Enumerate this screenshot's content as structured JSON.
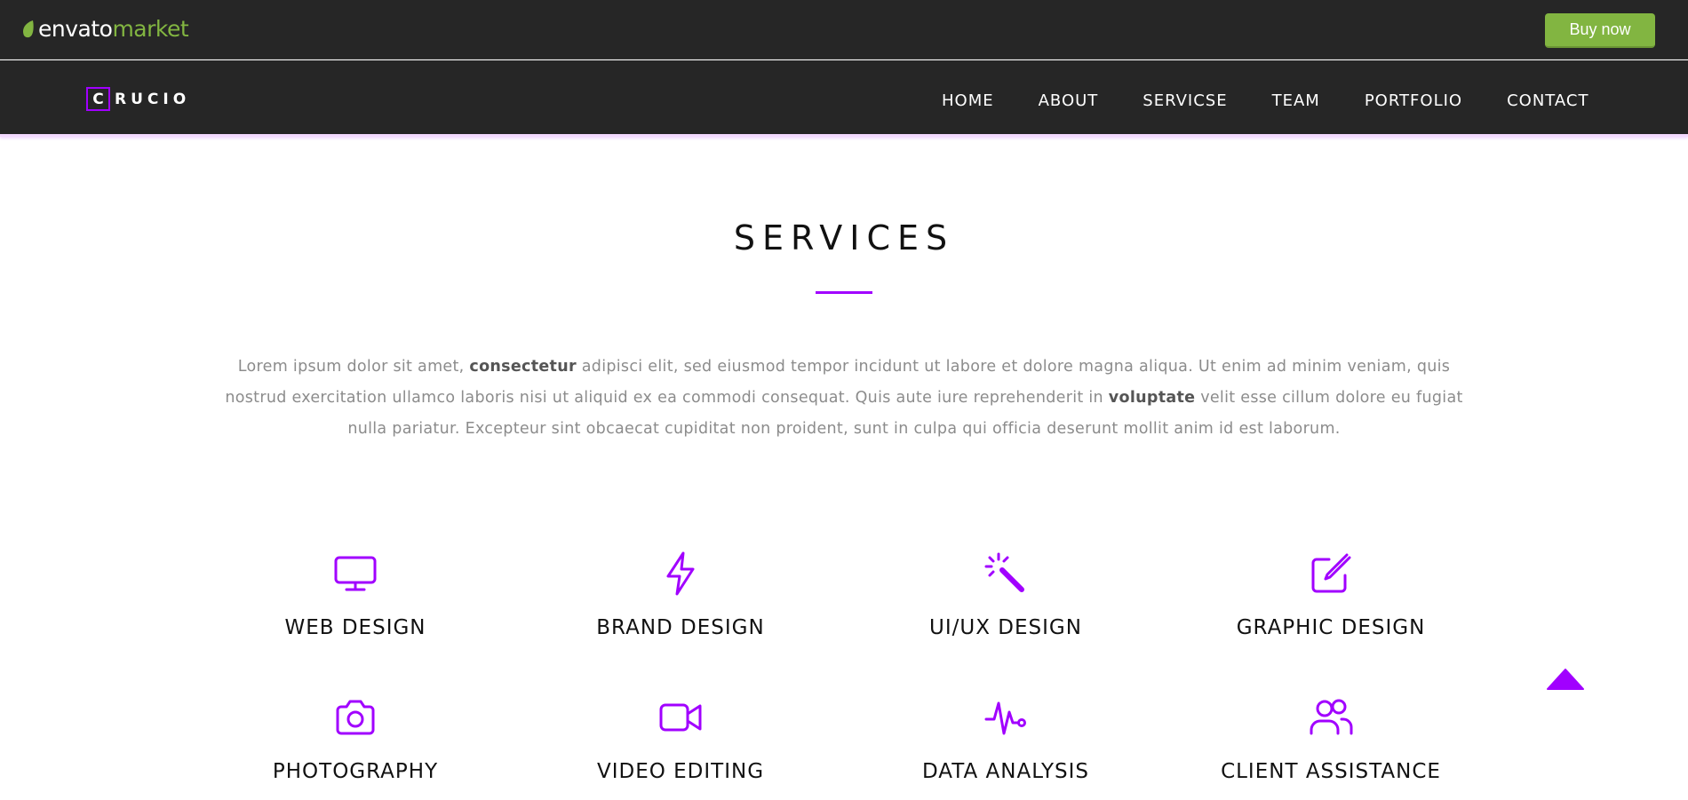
{
  "envato": {
    "logo_main": "envato",
    "logo_sub": "market",
    "buy_label": "Buy now",
    "brand_green": "#82b541"
  },
  "site": {
    "brand_letter": "C",
    "brand_rest": "RUCIO",
    "accent": "#a100ff",
    "nav": [
      "HOME",
      "ABOUT",
      "SERVICSE",
      "TEAM",
      "PORTFOLIO",
      "CONTACT"
    ]
  },
  "services": {
    "title": "SERVICES",
    "intro_parts": [
      "Lorem ipsum dolor sit amet, ",
      "consectetur",
      " adipisci elit, sed eiusmod tempor incidunt ut labore et dolore magna aliqua. Ut enim ad minim veniam, quis nostrud exercitation ullamco laboris nisi ut aliquid ex ea commodi consequat. Quis aute iure reprehenderit in ",
      "voluptate",
      " velit esse cillum dolore eu fugiat nulla pariatur. Excepteur sint obcaecat cupiditat non proident, sunt in culpa qui officia deserunt mollit anim id est laborum."
    ],
    "items": [
      {
        "label": "WEB DESIGN",
        "icon": "monitor-icon"
      },
      {
        "label": "BRAND DESIGN",
        "icon": "lightning-icon"
      },
      {
        "label": "UI/UX DESIGN",
        "icon": "magic-wand-icon"
      },
      {
        "label": "GRAPHIC DESIGN",
        "icon": "edit-icon"
      },
      {
        "label": "PHOTOGRAPHY",
        "icon": "camera-icon"
      },
      {
        "label": "VIDEO EDITING",
        "icon": "video-icon"
      },
      {
        "label": "DATA ANALYSIS",
        "icon": "pulse-icon"
      },
      {
        "label": "CLIENT ASSISTANCE",
        "icon": "users-icon"
      }
    ]
  },
  "scroll_top": {
    "icon": "arrow-up-icon"
  }
}
